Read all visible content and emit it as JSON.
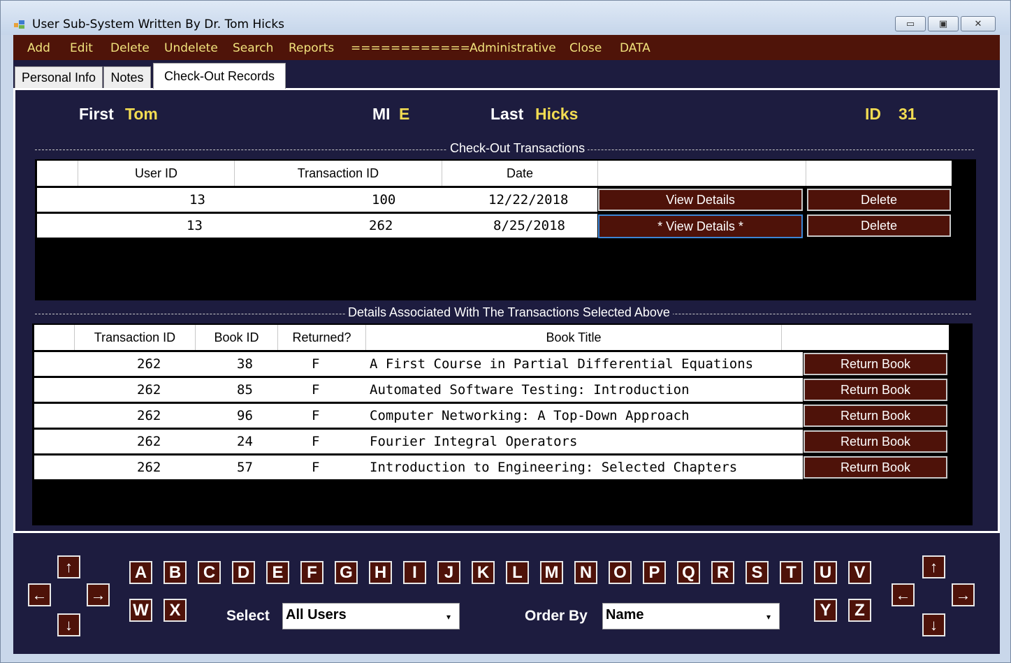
{
  "window": {
    "title": "User Sub-System Written By Dr. Tom Hicks",
    "minimize": "▭",
    "maximize": "▣",
    "close": "✕"
  },
  "menu": [
    "Add",
    "Edit",
    "Delete",
    "Undelete",
    "Search",
    "Reports",
    "============",
    "Administrative",
    "Close",
    "DATA"
  ],
  "tabs": [
    "Personal Info",
    "Notes",
    "Check-Out Records"
  ],
  "user": {
    "first_label": "First",
    "first": "Tom",
    "mi_label": "MI",
    "mi": "E",
    "last_label": "Last",
    "last": "Hicks",
    "id_label": "ID",
    "id": "31"
  },
  "transactions": {
    "title": "Check-Out Transactions",
    "columns": [
      "User ID",
      "Transaction ID",
      "Date"
    ],
    "rows": [
      {
        "user_id": "13",
        "transaction_id": "100",
        "date": "12/22/2018",
        "view": "View Details",
        "delete": "Delete"
      },
      {
        "user_id": "13",
        "transaction_id": "262",
        "date": "8/25/2018",
        "view": "* View Details *",
        "delete": "Delete"
      }
    ]
  },
  "details": {
    "title": "Details Associated With The Transactions Selected Above",
    "columns": [
      "Transaction ID",
      "Book ID",
      "Returned?",
      "Book Title"
    ],
    "rows": [
      {
        "transaction_id": "262",
        "book_id": "38",
        "returned": "F",
        "title": "A First Course in Partial Differential Equations",
        "action": "Return Book"
      },
      {
        "transaction_id": "262",
        "book_id": "85",
        "returned": "F",
        "title": "Automated Software Testing: Introduction",
        "action": "Return Book"
      },
      {
        "transaction_id": "262",
        "book_id": "96",
        "returned": "F",
        "title": "Computer Networking: A Top-Down Approach",
        "action": "Return Book"
      },
      {
        "transaction_id": "262",
        "book_id": "24",
        "returned": "F",
        "title": "Fourier Integral Operators",
        "action": "Return Book"
      },
      {
        "transaction_id": "262",
        "book_id": "57",
        "returned": "F",
        "title": "Introduction to Engineering: Selected Chapters",
        "action": "Return Book"
      }
    ]
  },
  "letters_row1": [
    "A",
    "B",
    "C",
    "D",
    "E",
    "F",
    "G",
    "H",
    "I",
    "J",
    "K",
    "L",
    "M",
    "N",
    "O",
    "P",
    "Q",
    "R",
    "S",
    "T",
    "U",
    "V"
  ],
  "letters_row2_left": [
    "W",
    "X"
  ],
  "letters_row2_right": [
    "Y",
    "Z"
  ],
  "arrows": {
    "up": "↑",
    "left": "←",
    "right": "→",
    "down": "↓"
  },
  "select": {
    "label": "Select",
    "value": "All Users"
  },
  "order_by": {
    "label": "Order By",
    "value": "Name"
  },
  "combo_arrow": "▾",
  "colors": {
    "menu_bg": "#4f1409",
    "menu_text": "#f1e27c",
    "panel_bg": "#1d1c3f",
    "value_yellow": "#f2dc52",
    "button_maroon": "#4e1209"
  }
}
